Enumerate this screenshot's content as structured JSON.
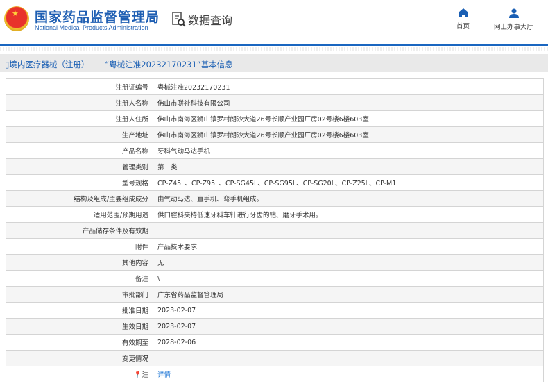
{
  "header": {
    "title_cn": "国家药品监督管理局",
    "title_en": "National Medical Products Administration",
    "query_label": "数据查询",
    "nav": [
      {
        "label": "首页",
        "icon": "home-icon"
      },
      {
        "label": "网上办事大厅",
        "icon": "user-icon"
      }
    ]
  },
  "page_title": "境内医疗器械（注册）——“粤械注准20232170231”基本信息",
  "rows": [
    {
      "label": "注册证编号",
      "value": "粤械注准20232170231"
    },
    {
      "label": "注册人名称",
      "value": "佛山市骈祉科技有限公司"
    },
    {
      "label": "注册人住所",
      "value": "佛山市南海区狮山镇罗村朗沙大道26号长顺产业园厂房02号楼6楼603室"
    },
    {
      "label": "生产地址",
      "value": "佛山市南海区狮山镇罗村朗沙大道26号长顺产业园厂房02号楼6楼603室"
    },
    {
      "label": "产品名称",
      "value": "牙科气动马达手机"
    },
    {
      "label": "管理类别",
      "value": "第二类"
    },
    {
      "label": "型号规格",
      "value": "CP-Z45L、CP-Z95L、CP-SG45L、CP-SG95L、CP-SG20L、CP-Z25L、CP-M1"
    },
    {
      "label": "结构及组成/主要组成成分",
      "value": "由气动马达、直手机、弯手机组成。"
    },
    {
      "label": "适用范围/预期用途",
      "value": "供口腔科夹持低速牙科车针进行牙齿的钻、磨牙手术用。"
    },
    {
      "label": "产品储存条件及有效期",
      "value": ""
    },
    {
      "label": "附件",
      "value": "产品技术要求"
    },
    {
      "label": "其他内容",
      "value": "无"
    },
    {
      "label": "备注",
      "value": "\\"
    },
    {
      "label": "审批部门",
      "value": "广东省药品监督管理局"
    },
    {
      "label": "批准日期",
      "value": "2023-02-07"
    },
    {
      "label": "生效日期",
      "value": "2023-02-07"
    },
    {
      "label": "有效期至",
      "value": "2028-02-06"
    },
    {
      "label": "变更情况",
      "value": ""
    },
    {
      "label": "注",
      "value": "详情"
    }
  ]
}
